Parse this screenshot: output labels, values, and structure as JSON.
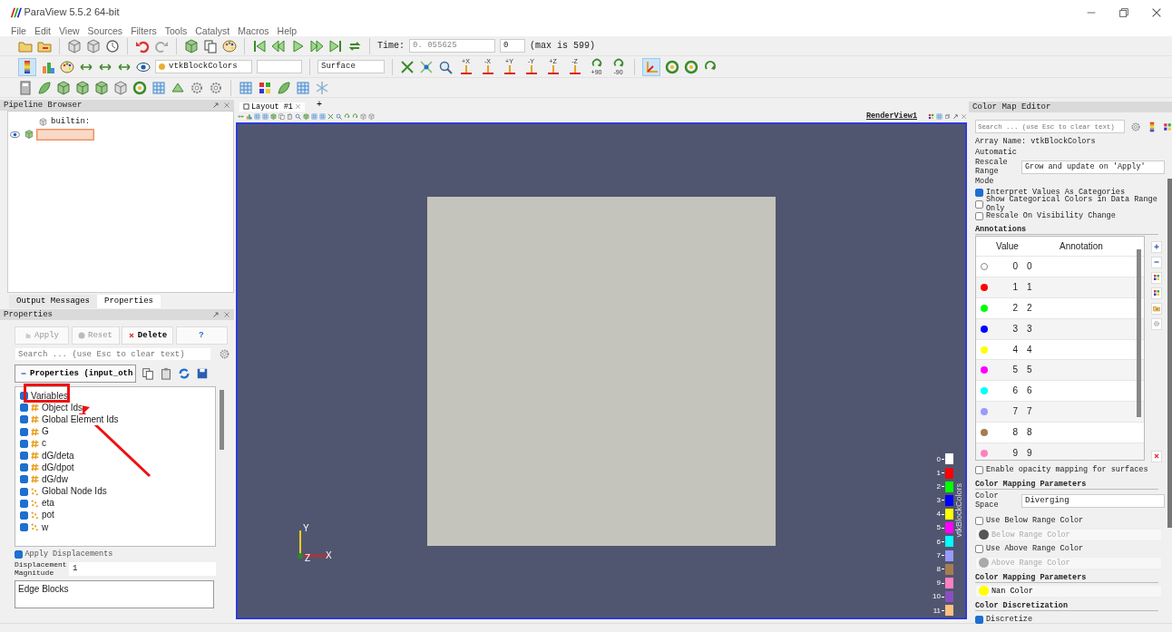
{
  "window": {
    "title": "ParaView 5.5.2 64-bit"
  },
  "menu": [
    "File",
    "Edit",
    "View",
    "Sources",
    "Filters",
    "Tools",
    "Catalyst",
    "Macros",
    "Help"
  ],
  "toolbar": {
    "time_label": "Time:",
    "time_value": "0. 055625",
    "timestep": "0",
    "max_label": "(max is 599)",
    "color_array": "vtkBlockColors",
    "representation": "Surface",
    "view_buttons": [
      "+X",
      "-X",
      "+Y",
      "-Y",
      "+Z",
      "-Z"
    ],
    "rotate_buttons": [
      "+90",
      "-90"
    ]
  },
  "pipeline_browser": {
    "title": "Pipeline Browser",
    "items": [
      {
        "kind": "server",
        "label": "builtin:",
        "selected": false
      },
      {
        "kind": "source",
        "selected": true,
        "visible": true
      }
    ]
  },
  "dock_tabs": [
    {
      "label": "Output Messages",
      "selected": false
    },
    {
      "label": "Properties",
      "selected": true
    }
  ],
  "properties": {
    "title": "Properties",
    "buttons": [
      {
        "kind": "apply",
        "label": "Apply",
        "disabled": true
      },
      {
        "kind": "reset",
        "label": "Reset",
        "disabled": true
      },
      {
        "kind": "delete",
        "label": "Delete",
        "disabled": false
      },
      {
        "kind": "help",
        "label": "?",
        "disabled": false
      }
    ],
    "search_placeholder": "Search ... (use Esc to clear text)",
    "section": "Properties (input_oth",
    "variables": {
      "label": "Variables",
      "checked": true,
      "items": [
        {
          "kind": "cell",
          "label": "Object Ids",
          "checked": true
        },
        {
          "kind": "cell",
          "label": "Global Element Ids",
          "checked": true
        },
        {
          "kind": "cell",
          "label": "G",
          "checked": true
        },
        {
          "kind": "cell",
          "label": "c",
          "checked": true
        },
        {
          "kind": "cell",
          "label": "dG/deta",
          "checked": true
        },
        {
          "kind": "cell",
          "label": "dG/dpot",
          "checked": true
        },
        {
          "kind": "cell",
          "label": "dG/dw",
          "checked": true
        },
        {
          "kind": "point",
          "label": "Global Node Ids",
          "checked": true
        },
        {
          "kind": "point",
          "label": "eta",
          "checked": true
        },
        {
          "kind": "point",
          "label": "pot",
          "checked": true
        },
        {
          "kind": "point",
          "label": "w",
          "checked": true
        }
      ]
    },
    "apply_displacements": {
      "label": "Apply Displacements",
      "checked": true
    },
    "displacement_magnitude": {
      "label": "Displacement Magnitude",
      "value": "1"
    },
    "edge_blocks": {
      "label": "Edge Blocks"
    }
  },
  "layout": {
    "tabs": [
      {
        "label": "Layout #1",
        "selected": true
      }
    ],
    "add_tab": "+",
    "view_title": "RenderView1",
    "axes": {
      "y": "Y",
      "z": "Z",
      "x": "X"
    },
    "legend": {
      "title": "vtkBlockColors",
      "entries": [
        {
          "label": "0",
          "color": "#ffffff"
        },
        {
          "label": "1",
          "color": "#ff0000"
        },
        {
          "label": "2",
          "color": "#00ff00"
        },
        {
          "label": "3",
          "color": "#0000ff"
        },
        {
          "label": "4",
          "color": "#ffff00"
        },
        {
          "label": "5",
          "color": "#ff00ff"
        },
        {
          "label": "6",
          "color": "#00ffff"
        },
        {
          "label": "7",
          "color": "#9999ff"
        },
        {
          "label": "8",
          "color": "#a67c52"
        },
        {
          "label": "9",
          "color": "#ff80c0"
        },
        {
          "label": "10",
          "color": "#8a4fbf"
        },
        {
          "label": "11",
          "color": "#ffc080"
        }
      ]
    }
  },
  "color_map_editor": {
    "title": "Color Map Editor",
    "search_placeholder": "Search ... (use Esc to clear text)",
    "array_name": "Array Name: vtkBlockColors",
    "rescale_label": "Automatic Rescale Range Mode",
    "rescale_mode": "Grow and update on 'Apply'",
    "options": [
      {
        "label": "Interpret Values As Categories",
        "checked": true
      },
      {
        "label": "Show Categorical Colors in Data Range Only",
        "checked": false
      },
      {
        "label": "Rescale On Visibility Change",
        "checked": false
      }
    ],
    "annotations_title": "Annotations",
    "columns": [
      "Value",
      "Annotation"
    ],
    "rows": [
      {
        "value": "0",
        "annotation": "0",
        "color": "#ffffff"
      },
      {
        "value": "1",
        "annotation": "1",
        "color": "#ff0000"
      },
      {
        "value": "2",
        "annotation": "2",
        "color": "#00ff00"
      },
      {
        "value": "3",
        "annotation": "3",
        "color": "#0000ff"
      },
      {
        "value": "4",
        "annotation": "4",
        "color": "#ffff00"
      },
      {
        "value": "5",
        "annotation": "5",
        "color": "#ff00ff"
      },
      {
        "value": "6",
        "annotation": "6",
        "color": "#00ffff"
      },
      {
        "value": "7",
        "annotation": "7",
        "color": "#9999ff"
      },
      {
        "value": "8",
        "annotation": "8",
        "color": "#a67c52"
      },
      {
        "value": "9",
        "annotation": "9",
        "color": "#ff80c0"
      }
    ],
    "parameters": [
      {
        "kind": "checkbox",
        "label": "Enable opacity mapping for surfaces",
        "checked": false
      },
      {
        "kind": "header",
        "label": "Color Mapping Parameters"
      },
      {
        "kind": "dropdown",
        "label": "Color Space",
        "value": "Diverging"
      },
      {
        "kind": "checkbox",
        "label": "Use Below Range Color",
        "checked": false
      },
      {
        "kind": "color",
        "label": "Below Range Color",
        "color": "#555555",
        "disabled": true
      },
      {
        "kind": "checkbox",
        "label": "Use Above Range Color",
        "checked": false
      },
      {
        "kind": "color",
        "label": "Above Range Color",
        "color": "#aaaaaa",
        "disabled": true
      },
      {
        "kind": "header",
        "label": "Color Mapping Parameters"
      },
      {
        "kind": "color",
        "label": "Nan Color",
        "color": "#ffff00",
        "disabled": false
      },
      {
        "kind": "header",
        "label": "Color Discretization"
      },
      {
        "kind": "checkbox",
        "label": "Discretize",
        "checked": true
      }
    ]
  }
}
